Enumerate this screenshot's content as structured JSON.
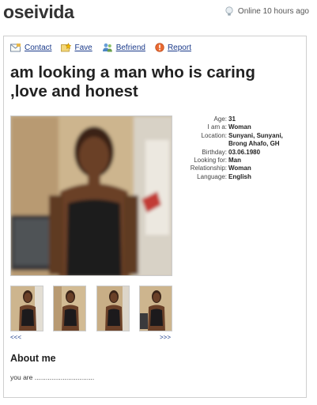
{
  "header": {
    "username": "oseivida",
    "online_status": "Online 10 hours ago",
    "status_icon": "lightbulb-icon"
  },
  "actions": [
    {
      "label": "Contact",
      "icon": "envelope-icon"
    },
    {
      "label": "Fave",
      "icon": "star-folder-icon"
    },
    {
      "label": "Befriend",
      "icon": "users-icon"
    },
    {
      "label": "Report",
      "icon": "warning-icon"
    }
  ],
  "profile": {
    "headline": "am looking a man who is caring ,love and honest",
    "info": [
      {
        "label": "Age:",
        "value": "31"
      },
      {
        "label": "I am a:",
        "value": "Woman"
      },
      {
        "label": "Location:",
        "value": "Sunyani, Sunyani, Brong Ahafo, GH"
      },
      {
        "label": "Birthday:",
        "value": "03.06.1980"
      },
      {
        "label": "Looking for:",
        "value": "Man"
      },
      {
        "label": "Relationship:",
        "value": "Woman"
      },
      {
        "label": "Language:",
        "value": "English"
      }
    ]
  },
  "gallery": {
    "prev_label": "<<<",
    "next_label": ">>>",
    "thumb_count": 4
  },
  "about": {
    "title": "About me",
    "text": "you are ................................"
  },
  "colors": {
    "link": "#1a3a8a",
    "border": "#cfcfcf"
  }
}
